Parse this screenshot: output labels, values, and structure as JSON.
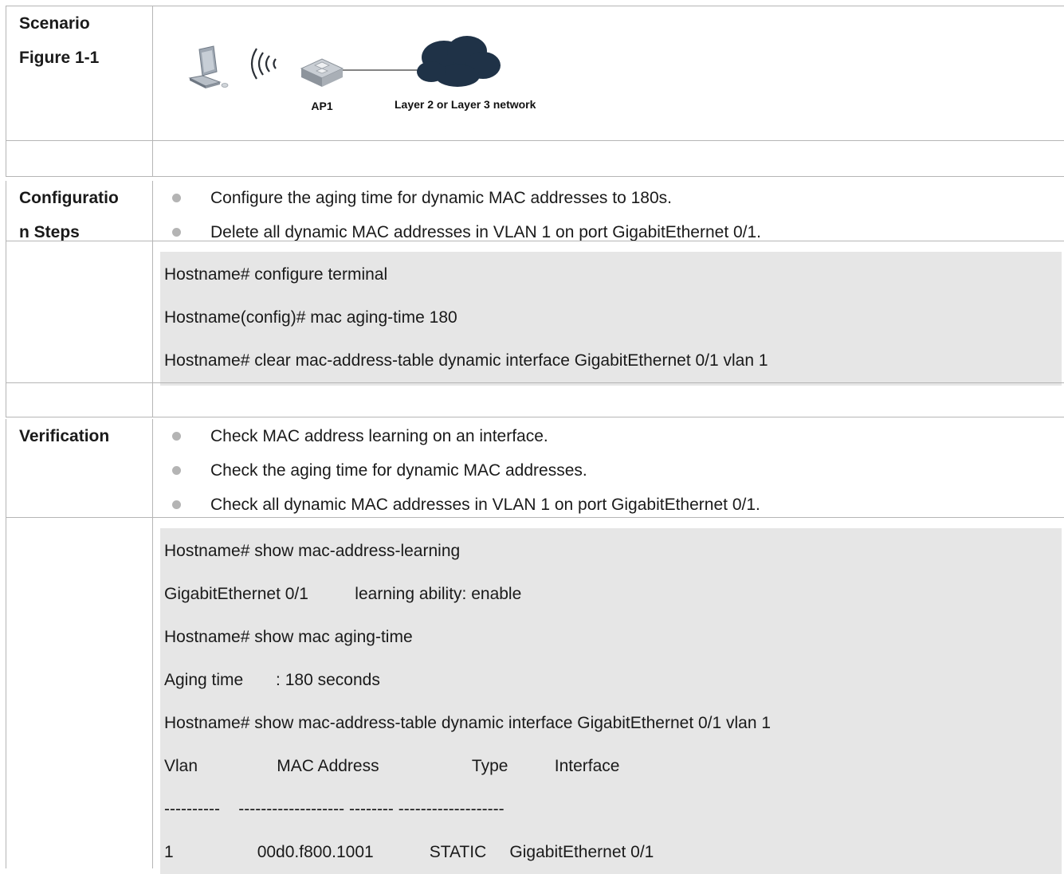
{
  "scenario": {
    "label_line1": "Scenario",
    "label_line2": "Figure 1-1",
    "figure": {
      "ap_label": "AP1",
      "network_label": "Layer 2 or Layer 3 network"
    }
  },
  "configuration": {
    "label_line1": "Configuratio",
    "label_line2": "n Steps",
    "bullets": [
      "Configure the aging time for dynamic MAC addresses to 180s.",
      "Delete all dynamic MAC addresses in VLAN 1 on port GigabitEthernet 0/1."
    ],
    "code": [
      "Hostname# configure terminal",
      "Hostname(config)# mac aging-time 180",
      "Hostname# clear mac-address-table dynamic interface GigabitEthernet 0/1 vlan 1"
    ]
  },
  "verification": {
    "label": "Verification",
    "bullets": [
      "Check MAC address learning on an interface.",
      "Check the aging time for dynamic MAC addresses.",
      "Check all dynamic MAC addresses in VLAN 1 on port GigabitEthernet 0/1."
    ],
    "code": [
      "Hostname# show mac-address-learning",
      "GigabitEthernet 0/1          learning ability: enable",
      "Hostname# show mac aging-time",
      "Aging time       : 180 seconds",
      "Hostname# show mac-address-table dynamic interface GigabitEthernet 0/1 vlan 1",
      "Vlan                 MAC Address                    Type          Interface",
      "----------    ------------------- -------- -------------------",
      "1                  00d0.f800.1001            STATIC     GigabitEthernet 0/1"
    ]
  }
}
